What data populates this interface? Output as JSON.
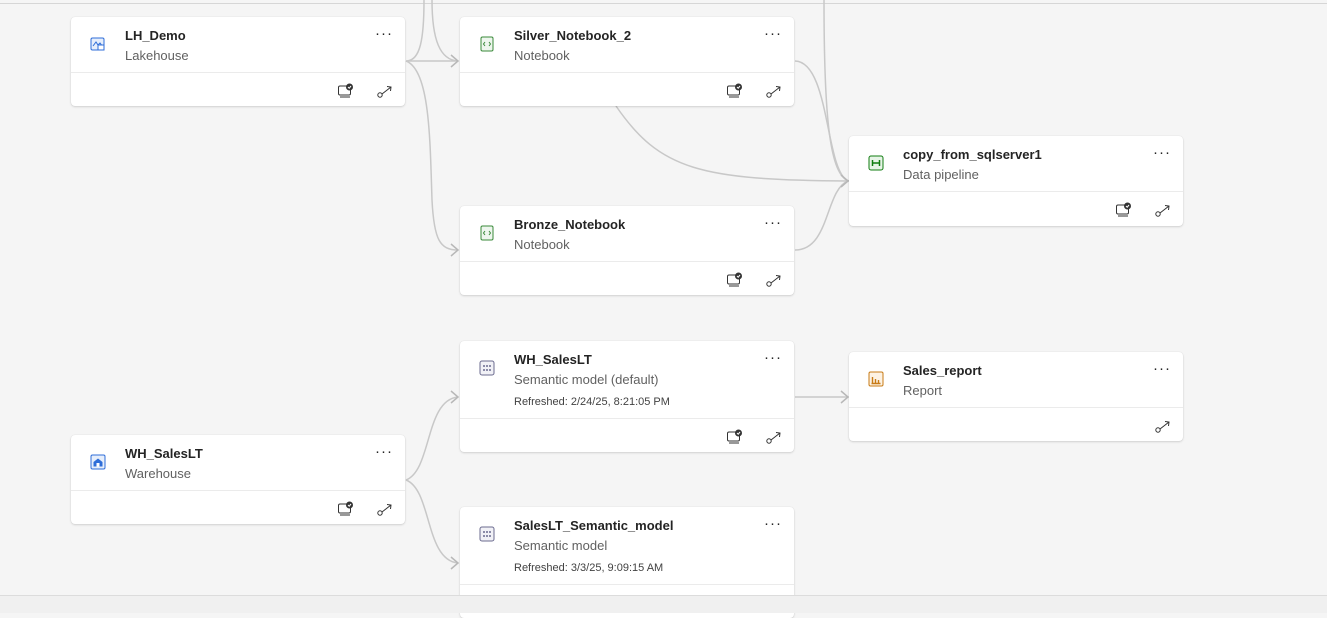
{
  "canvas": {
    "nodes": [
      {
        "id": "lh_demo",
        "title": "LH_Demo",
        "type": "Lakehouse",
        "icon": "lakehouse-icon"
      },
      {
        "id": "silver_nb",
        "title": "Silver_Notebook_2",
        "type": "Notebook",
        "icon": "notebook-icon"
      },
      {
        "id": "copy_pipeline",
        "title": "copy_from_sqlserver1",
        "type": "Data pipeline",
        "icon": "pipeline-icon"
      },
      {
        "id": "bronze_nb",
        "title": "Bronze_Notebook",
        "type": "Notebook",
        "icon": "notebook-icon"
      },
      {
        "id": "wh_saleslt_sm",
        "title": "WH_SalesLT",
        "type": "Semantic model (default)",
        "refreshed": "Refreshed: 2/24/25, 8:21:05 PM",
        "icon": "semantic-model-icon"
      },
      {
        "id": "sales_report",
        "title": "Sales_report",
        "type": "Report",
        "icon": "report-icon"
      },
      {
        "id": "wh_saleslt",
        "title": "WH_SalesLT",
        "type": "Warehouse",
        "icon": "warehouse-icon"
      },
      {
        "id": "saleslt_sm",
        "title": "SalesLT_Semantic_model",
        "type": "Semantic model",
        "refreshed": "Refreshed: 3/3/25, 9:09:15 AM",
        "icon": "semantic-model-icon"
      }
    ],
    "more_label": "···",
    "action_icons": [
      "impact-analysis-icon",
      "lineage-icon"
    ],
    "colors": {
      "edge": "#c8c8c8",
      "lakehouse": "#2f6ed8",
      "notebook": "#3a8a3a",
      "pipeline": "#107c10",
      "report": "#c87b16",
      "semantic": "#6b6b8f"
    }
  }
}
